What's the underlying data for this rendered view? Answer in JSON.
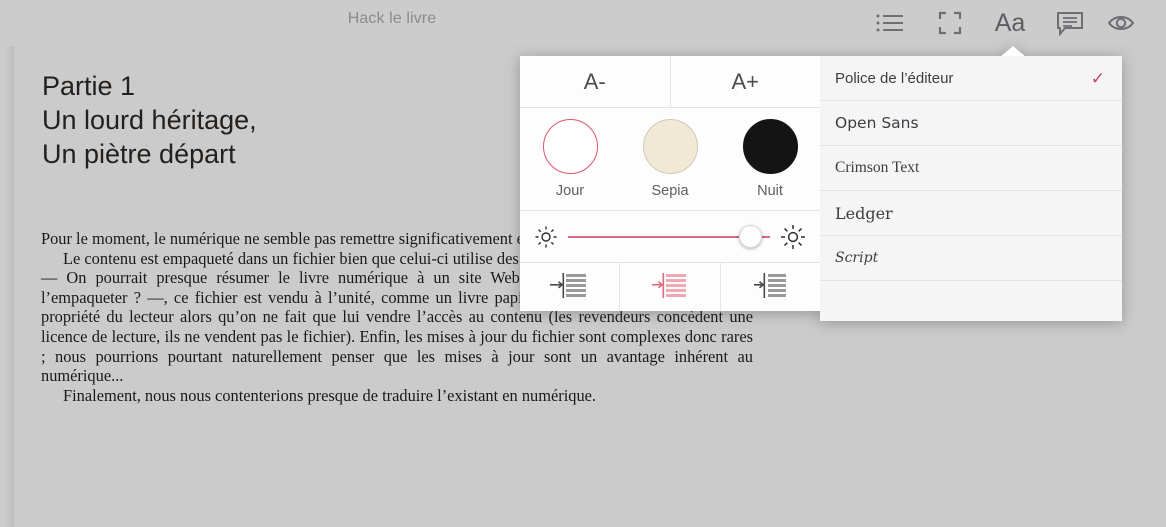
{
  "header": {
    "book_title": "Hack le livre",
    "icons": [
      {
        "name": "toc-icon",
        "label": "Table des matières"
      },
      {
        "name": "fullscreen-icon",
        "label": "Plein écran"
      },
      {
        "name": "font-settings-icon",
        "label": "Aa"
      },
      {
        "name": "comments-icon",
        "label": "Commentaires"
      },
      {
        "name": "eye-icon",
        "label": "Aperçu"
      }
    ],
    "aa_label": "Aa"
  },
  "reader": {
    "heading_lines": [
      "Partie 1",
      "Un lourd héritage,",
      "Un piètre départ"
    ],
    "paragraphs": [
      "Pour le moment, le numérique ne semble pas remettre significativement en cause le livre.",
      "Le contenu est empaqueté dans un fichier bien que celui-ci utilise des technologies Web pour fonctionner — On pourrait presque résumer le livre numérique à un site Web empaqueté, mais pourquoi alors l’empaqueter ? —, ce fichier est vendu à l’unité, comme un livre papier, laissant penser qu’il devient la propriété du lecteur alors qu’on ne fait que lui vendre l’accès au contenu (les revendeurs concèdent une licence de lecture, ils ne vendent pas le fichier). Enfin, les mises à jour du fichier sont complexes donc rares ; nous pourrions pourtant naturellement penser que les mises à jour sont un avantage inhérent au numérique...",
      "Finalement, nous nous contenterions presque de traduire l’existant en numérique."
    ]
  },
  "popover": {
    "size_controls": [
      {
        "name": "decrease-font-size",
        "label": "A-"
      },
      {
        "name": "increase-font-size",
        "label": "A+"
      }
    ],
    "themes": [
      {
        "name": "theme-jour",
        "label": "Jour",
        "color": "#ffffff",
        "selected": true
      },
      {
        "name": "theme-sepia",
        "label": "Sepia",
        "color": "#efe9d6",
        "selected": false
      },
      {
        "name": "theme-nuit",
        "label": "Nuit",
        "color": "#141414",
        "selected": false
      }
    ],
    "brightness": {
      "label_low": "Luminosité min",
      "label_high": "Luminosité max",
      "value": 94
    },
    "alignment": [
      {
        "name": "align-indent-none",
        "label": "Sans retrait",
        "selected": false
      },
      {
        "name": "align-indent-first",
        "label": "Retrait alinéa",
        "selected": true
      },
      {
        "name": "align-indent-block",
        "label": "Retrait bloc",
        "selected": false
      }
    ],
    "fonts": [
      {
        "name": "font-police-editeur",
        "label": "Police de l’éditeur",
        "selected": true
      },
      {
        "name": "font-open-sans",
        "label": "Open Sans",
        "selected": false
      },
      {
        "name": "font-crimson-text",
        "label": "Crimson Text",
        "selected": false
      },
      {
        "name": "font-ledger",
        "label": "Ledger",
        "selected": false
      },
      {
        "name": "font-script",
        "label": "Script",
        "selected": false
      }
    ],
    "check_glyph": "✓"
  },
  "colors": {
    "accent": "#c8485f",
    "slider": "#d66a80",
    "background": "#cccccc",
    "panel": "#fdfdfd",
    "panel_alt": "#f5f5f5"
  }
}
